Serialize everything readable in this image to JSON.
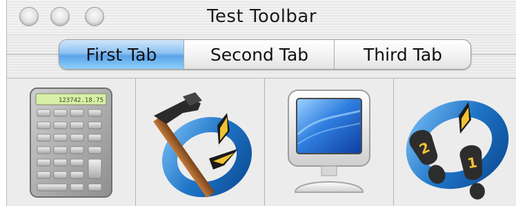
{
  "window": {
    "title": "Test Toolbar",
    "controls": [
      "close-button",
      "minimize-button",
      "zoom-button"
    ]
  },
  "tabs": [
    {
      "label": "First Tab",
      "selected": true
    },
    {
      "label": "Second Tab",
      "selected": false
    },
    {
      "label": "Third Tab",
      "selected": false
    }
  ],
  "toolbar": {
    "items": [
      {
        "icon": "calculator-icon",
        "display": "123742.18.75"
      },
      {
        "icon": "hammer-quicktime-icon"
      },
      {
        "icon": "monitor-icon"
      },
      {
        "icon": "footprints-quicktime-icon",
        "step_numbers": [
          "2",
          "1"
        ]
      }
    ]
  },
  "colors": {
    "selected_tab": "#5aa3e8",
    "quicktime_ring": "#1f74c6",
    "calculator_display": "#d7f0a8"
  }
}
